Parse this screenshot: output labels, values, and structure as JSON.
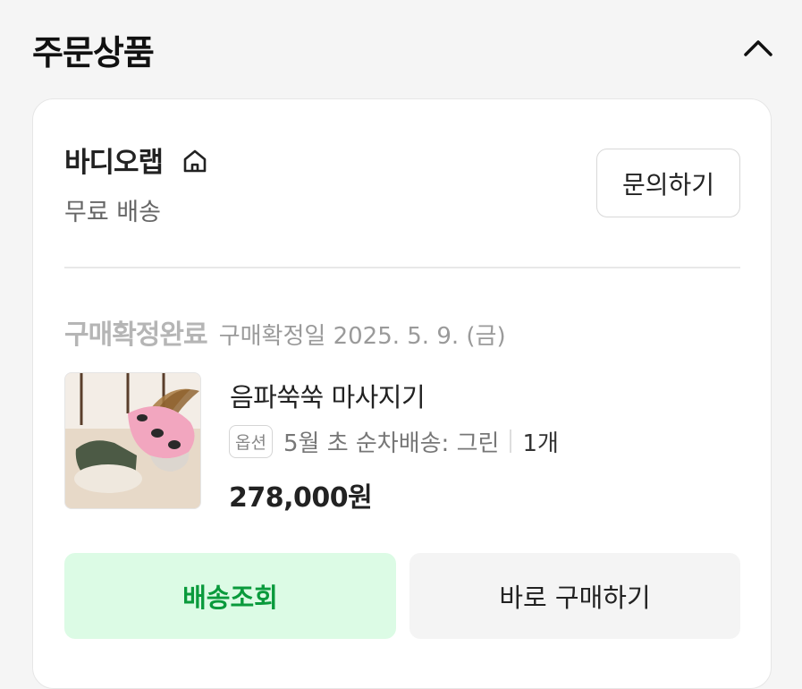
{
  "header": {
    "title": "주문상품",
    "collapse_icon": "chevron-up-icon"
  },
  "seller": {
    "name": "바디오랩",
    "icon": "home-icon",
    "shipping": "무료 배송",
    "inquiry_label": "문의하기"
  },
  "order": {
    "status": "구매확정완료",
    "confirm_date": "구매확정일 2025. 5. 9. (금)"
  },
  "product": {
    "name": "음파쑥쑥 마사지기",
    "option_badge": "옵션",
    "option_text": "5월 초 순차배송: 그린",
    "quantity": "1개",
    "price": "278,000원",
    "thumbnail": "product-image"
  },
  "actions": {
    "track_label": "배송조회",
    "buy_again_label": "바로 구매하기"
  },
  "colors": {
    "accent_green": "#0a9a3c",
    "track_bg": "#dcfbe5",
    "status_gray": "#b5b5b5"
  }
}
